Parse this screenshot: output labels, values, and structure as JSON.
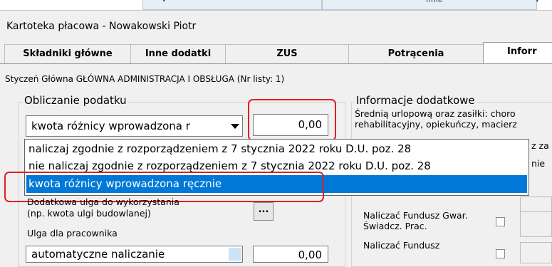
{
  "window": {
    "title": "Kartoteka płacowa - Nowakowski Piotr",
    "top_fragment": "imie"
  },
  "tabs": [
    {
      "label": "Składniki główne"
    },
    {
      "label": "Inne dodatki"
    },
    {
      "label": "ZUS"
    },
    {
      "label": "Potrącenia"
    },
    {
      "label": "Inforr"
    }
  ],
  "payroll_info": "Styczeń Główna GŁÓWNA ADMINISTRACJA I OBSŁUGA  (Nr listy: 1)",
  "tax_group": {
    "legend": "Obliczanie podatku",
    "combo_value": "kwota różnicy wprowadzona r",
    "amount": "0,00",
    "dropdown_options": [
      "naliczaj zgodnie z rozporządzeniem z 7 stycznia 2022 roku D.U. poz. 28",
      "nie naliczaj zgodnie z rozporządzeniem z 7 stycznia 2022 roku D.U. poz. 28",
      "kwota różnicy wprowadzona ręcznie"
    ],
    "selected_index": 2,
    "extra_relief_label_1": "Dodatkowa ulga do wykorzystania",
    "extra_relief_label_2": "(np. kwota ulgi budowlanej)",
    "ellipsis": "...",
    "employee_relief_label": "Ulga dla pracownika",
    "employee_relief_value": "automatyczne naliczanie",
    "employee_relief_amount": "0,00"
  },
  "additional_info": {
    "legend": "Informacje dodatkowe",
    "line1": "Średnią urlopową oraz zasiłki: choro",
    "line2": "rehabilitacyjny, opiekuńczy, macierz",
    "line3": "z za c",
    "line4": "nie",
    "fgsp_label_1": "Naliczać Fundusz Gwar.",
    "fgsp_label_2": "Świadcz. Prac.",
    "fund_label": "Naliczać Fundusz"
  },
  "colors": {
    "highlight": "#0078d7",
    "annotation_red": "#e02020"
  }
}
